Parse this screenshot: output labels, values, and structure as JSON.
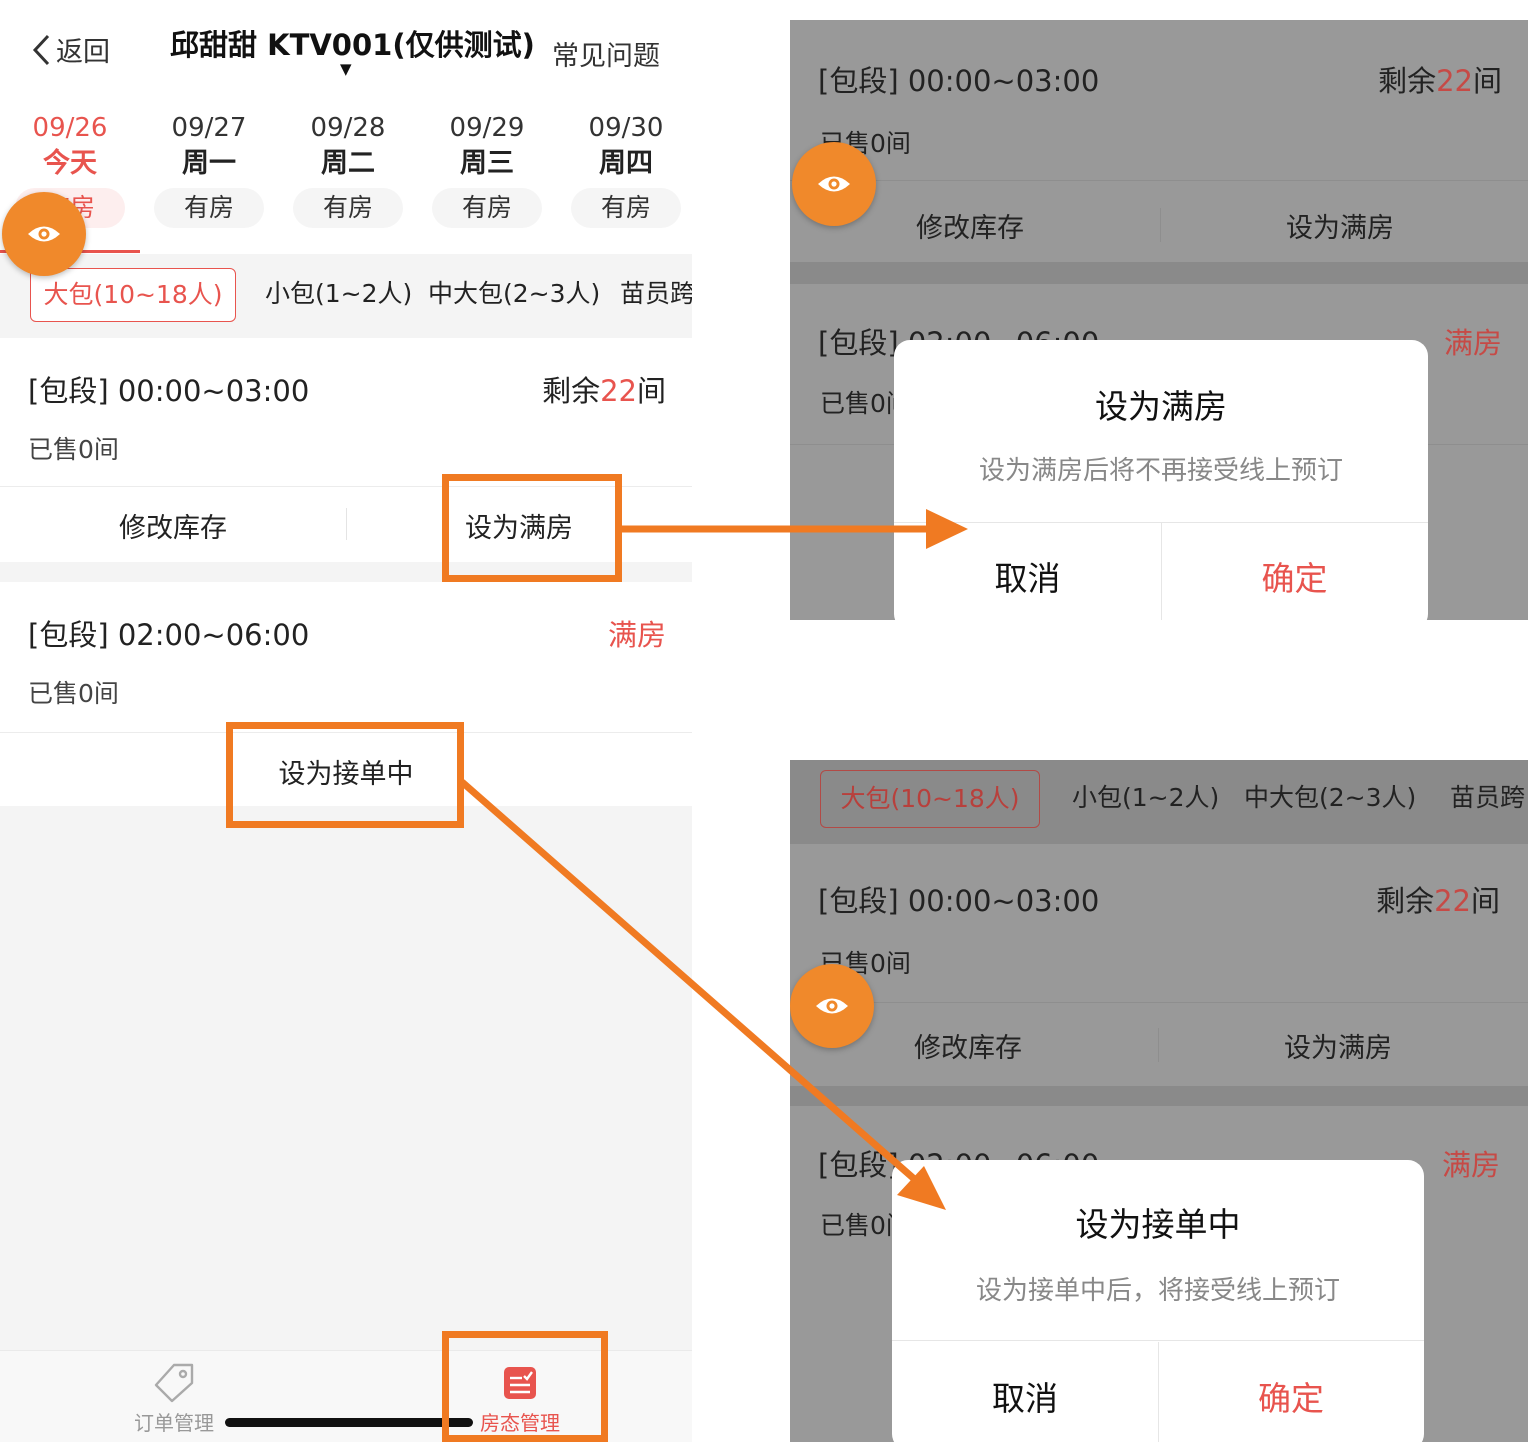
{
  "colors": {
    "accent": "#e8544e",
    "highlight": "#f07a22",
    "fab": "#f0892b"
  },
  "nav": {
    "back": "返回",
    "title": "邱甜甜 KTV001(仅供测试)",
    "caret": "▼",
    "faq": "常见问题"
  },
  "days": [
    {
      "date": "09/26",
      "weekday": "今天",
      "status": "有房"
    },
    {
      "date": "09/27",
      "weekday": "周一",
      "status": "有房"
    },
    {
      "date": "09/28",
      "weekday": "周二",
      "status": "有房"
    },
    {
      "date": "09/29",
      "weekday": "周三",
      "status": "有房"
    },
    {
      "date": "09/30",
      "weekday": "周四",
      "status": "有房"
    }
  ],
  "room_tabs": [
    "大包(10~18人)",
    "小包(1~2人)",
    "中大包(2~3人)",
    "苗员跨"
  ],
  "card1": {
    "segment": "[包段] 00:00~03:00",
    "remain_prefix": "剩余",
    "remain_num": "22",
    "remain_suffix": "间",
    "sold": "已售0间",
    "edit": "修改库存",
    "set_full": "设为满房"
  },
  "card2": {
    "segment": "[包段] 02:00~06:00",
    "status": "满房",
    "sold": "已售0间",
    "set_accept": "设为接单中"
  },
  "tabbar": {
    "orders": "订单管理",
    "rooms": "房态管理"
  },
  "panel1": {
    "segment1": "[包段] 00:00~03:00",
    "remain_prefix": "剩余",
    "remain_num": "22",
    "remain_suffix": "间",
    "sold1": "已售0间",
    "edit": "修改库存",
    "set_full": "设为满房",
    "segment2": "[包段] 02:00~06:00",
    "status2": "满房",
    "sold2": "已售0间",
    "dialog": {
      "title": "设为满房",
      "message": "设为满房后将不再接受线上预订",
      "cancel": "取消",
      "confirm": "确定"
    }
  },
  "panel2": {
    "tabs": [
      "大包(10~18人)",
      "小包(1~2人)",
      "中大包(2~3人)",
      "苗员跨"
    ],
    "segment1": "[包段] 00:00~03:00",
    "remain_prefix": "剩余",
    "remain_num": "22",
    "remain_suffix": "间",
    "sold1": "已售0间",
    "edit": "修改库存",
    "set_full": "设为满房",
    "segment2": "[包段] 02:00~06:00",
    "status2": "满房",
    "sold2": "已售0间",
    "dialog": {
      "title": "设为接单中",
      "message": "设为接单中后，将接受线上预订",
      "cancel": "取消",
      "confirm": "确定"
    }
  }
}
